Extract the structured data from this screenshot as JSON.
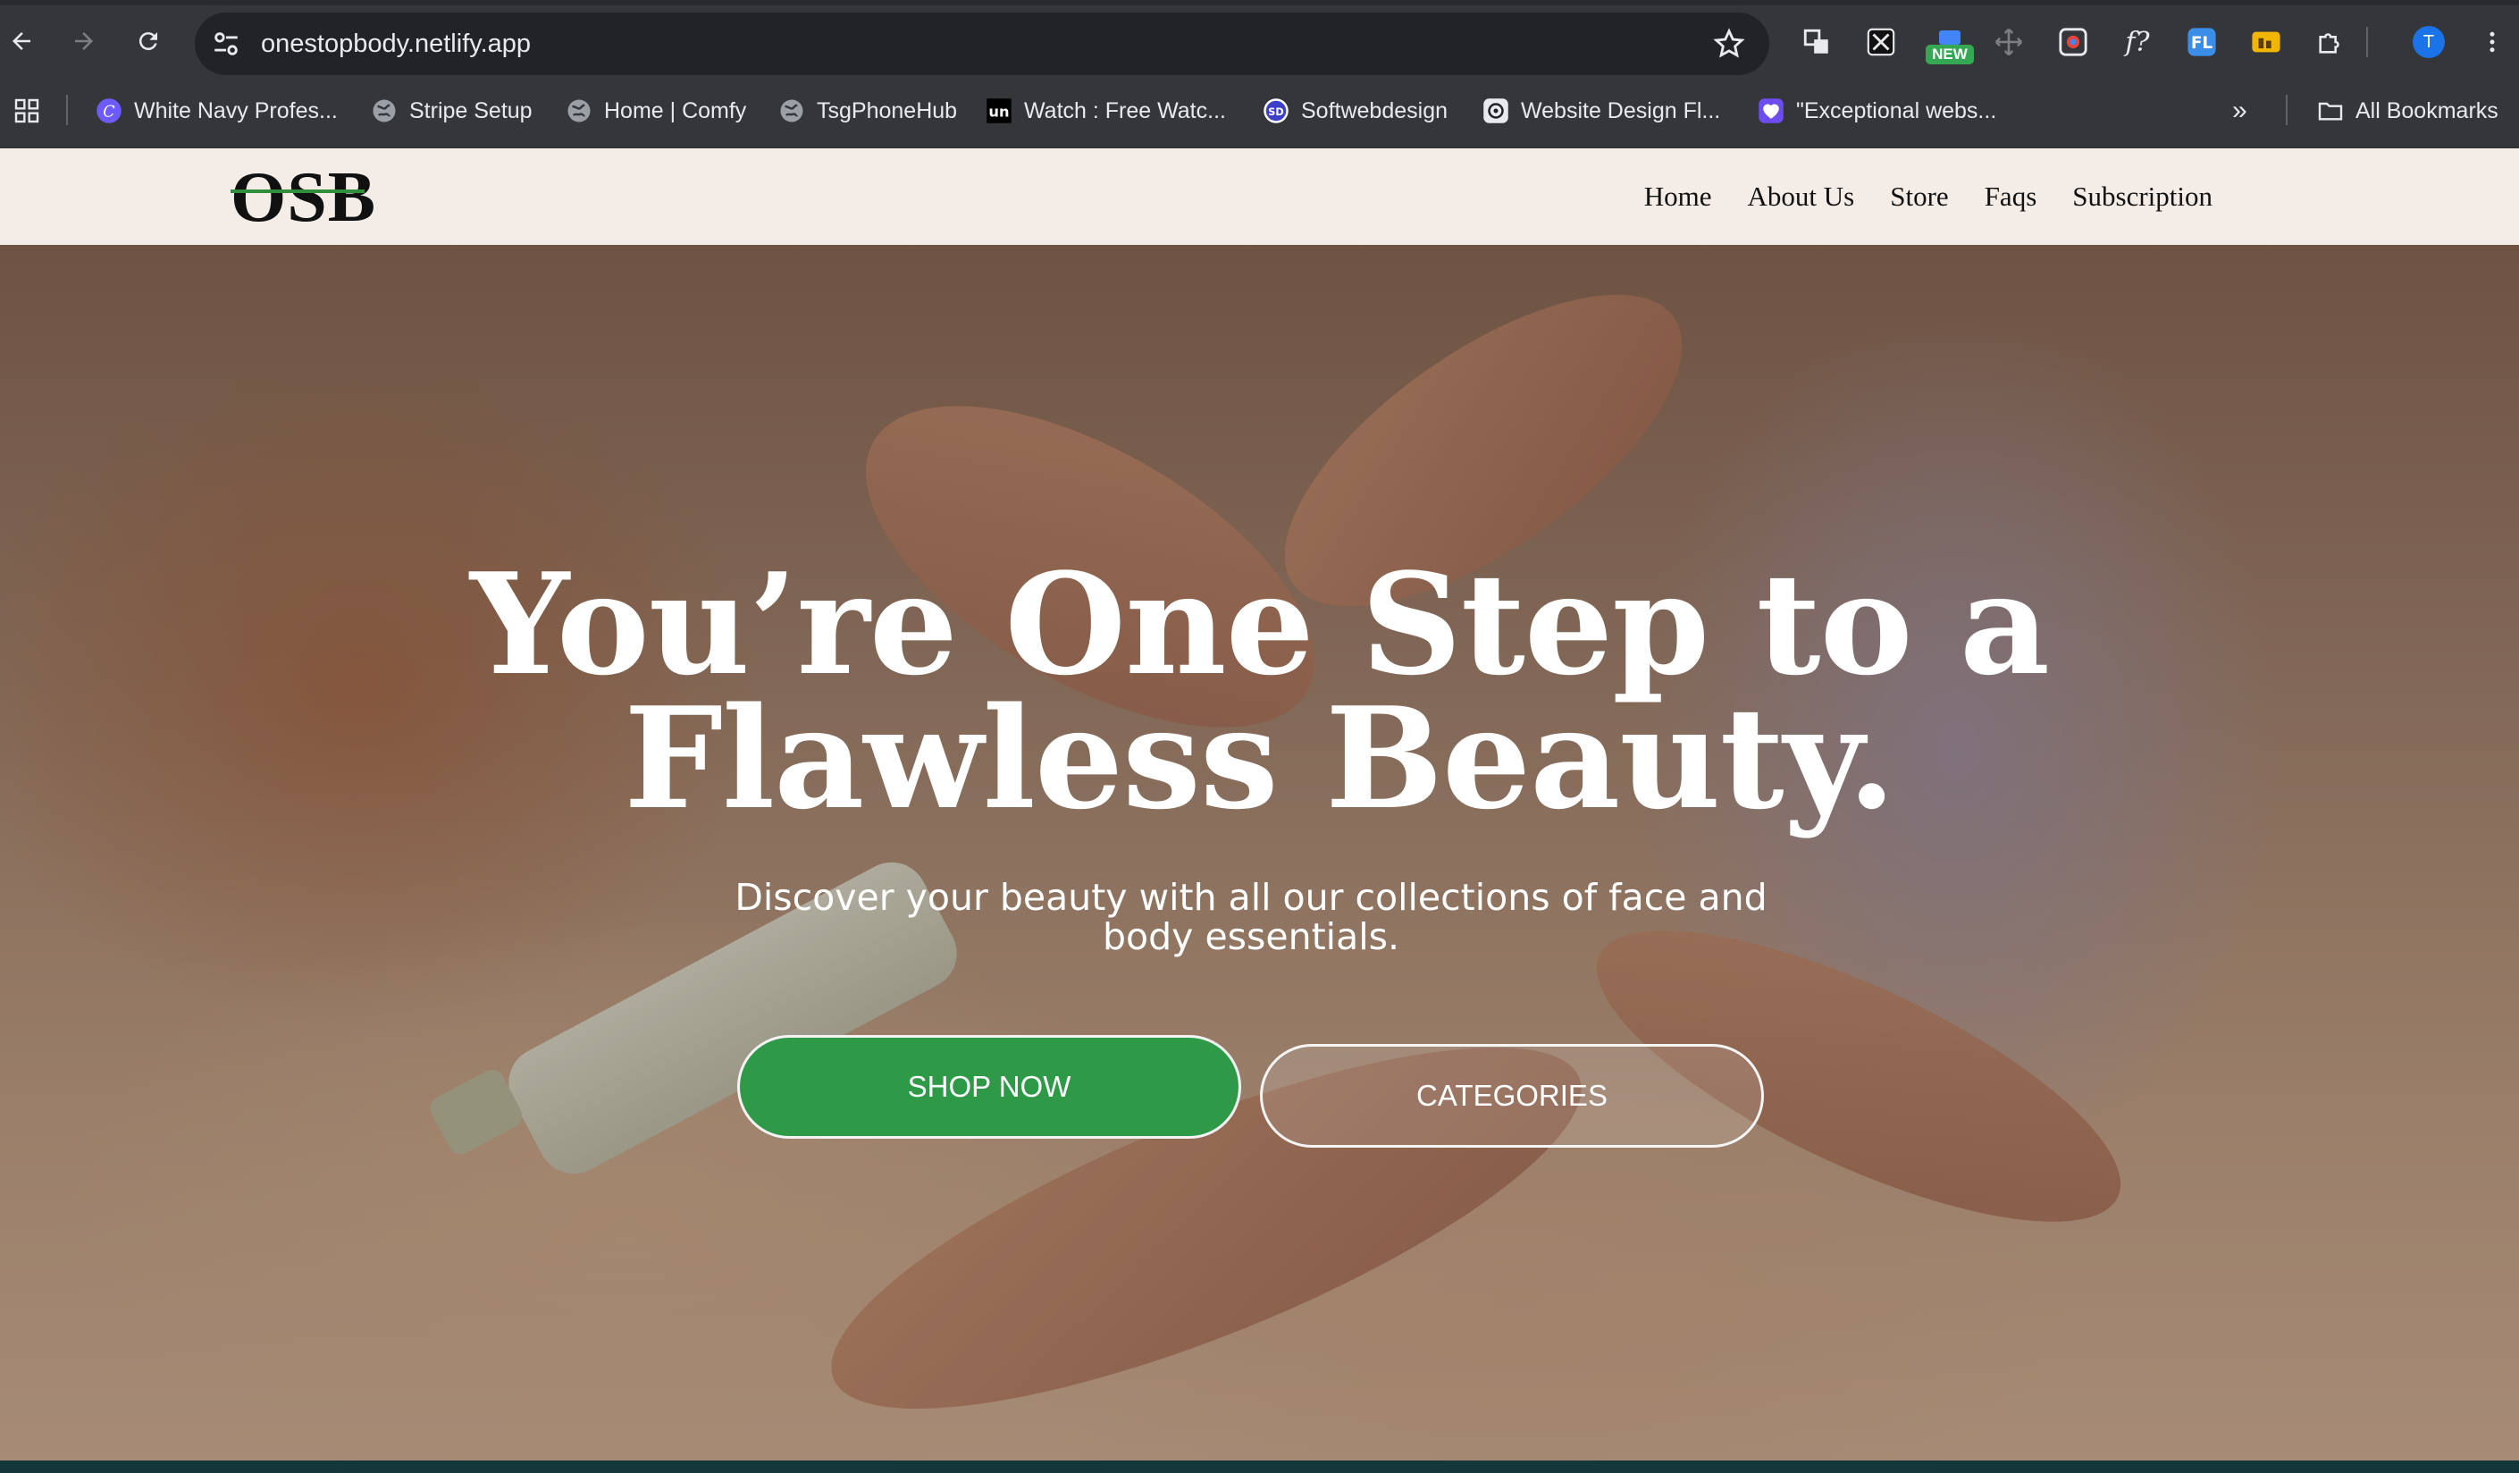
{
  "browser": {
    "url": "onestopbody.netlify.app",
    "bookmarks": [
      {
        "label": "White Navy Profes...",
        "icon": "canva-icon"
      },
      {
        "label": "Stripe Setup",
        "icon": "globe-icon"
      },
      {
        "label": "Home | Comfy",
        "icon": "globe-icon"
      },
      {
        "label": "TsgPhoneHub",
        "icon": "globe-icon"
      },
      {
        "label": "Watch : Free Watc...",
        "icon": "un-icon"
      },
      {
        "label": "Softwebdesign",
        "icon": "sd-icon"
      },
      {
        "label": "Website Design Fl...",
        "icon": "openai-icon"
      },
      {
        "label": "\"Exceptional webs...",
        "icon": "heart-icon"
      }
    ],
    "all_bookmarks_label": "All Bookmarks",
    "new_badge": "NEW",
    "profile_initial": "T",
    "colors": {
      "toolbar": "#35363a",
      "omnibox": "#222326",
      "profile": "#1a73e8"
    }
  },
  "site": {
    "logo": "OSB",
    "nav": [
      "Home",
      "About Us",
      "Store",
      "Faqs",
      "Subscription"
    ],
    "hero": {
      "headline_line1": "You’re One Step to a",
      "headline_line2": "Flawless Beauty.",
      "subtitle_line1": "Discover your beauty with all our collections of face and",
      "subtitle_line2": "body essentials.",
      "primary_cta": "SHOP NOW",
      "secondary_cta": "CATEGORIES"
    },
    "colors": {
      "header_bg": "#f3ece7",
      "accent_green": "#2e9a47",
      "logo_underline": "#2f8f3a"
    }
  }
}
